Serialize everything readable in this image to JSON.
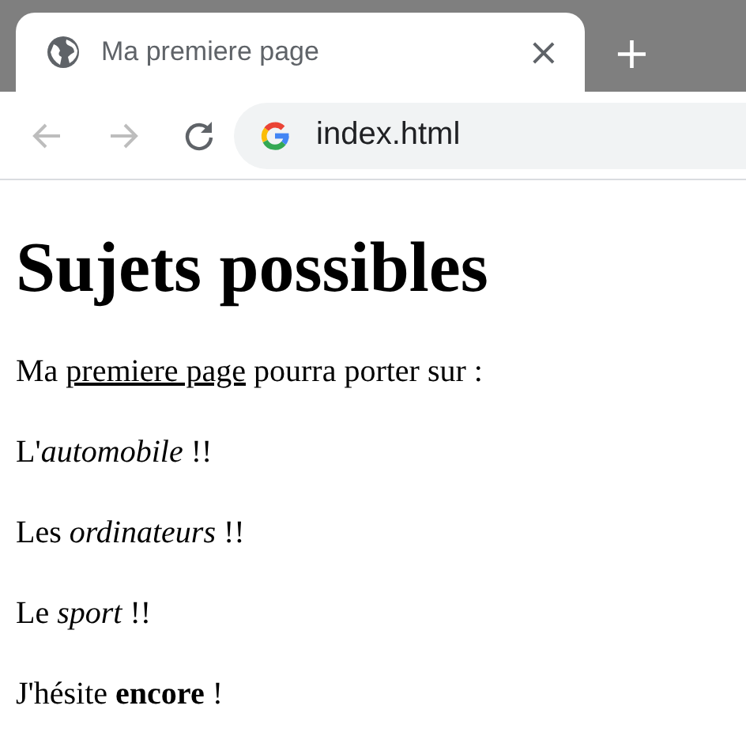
{
  "tabs": [
    {
      "title": "Ma premiere page",
      "selected": true,
      "close": "×"
    }
  ],
  "new_tab": "+",
  "toolbar": {
    "back": {
      "disabled": true
    },
    "forward": {
      "disabled": true
    },
    "address": "index.html"
  },
  "page": {
    "heading": "Sujets possibles",
    "paragraphs": [
      {
        "kind": "link_sentence",
        "before": "Ma ",
        "link": "premiere page",
        "after": " pourra porter sur :"
      },
      {
        "kind": "text",
        "text": "L'*automobile* !!"
      },
      {
        "kind": "text",
        "text": "Les *ordinateurs* !!"
      },
      {
        "kind": "text",
        "text": "Le *sport* !!"
      },
      {
        "kind": "text",
        "text": "J'hésite **encore** !"
      }
    ]
  }
}
